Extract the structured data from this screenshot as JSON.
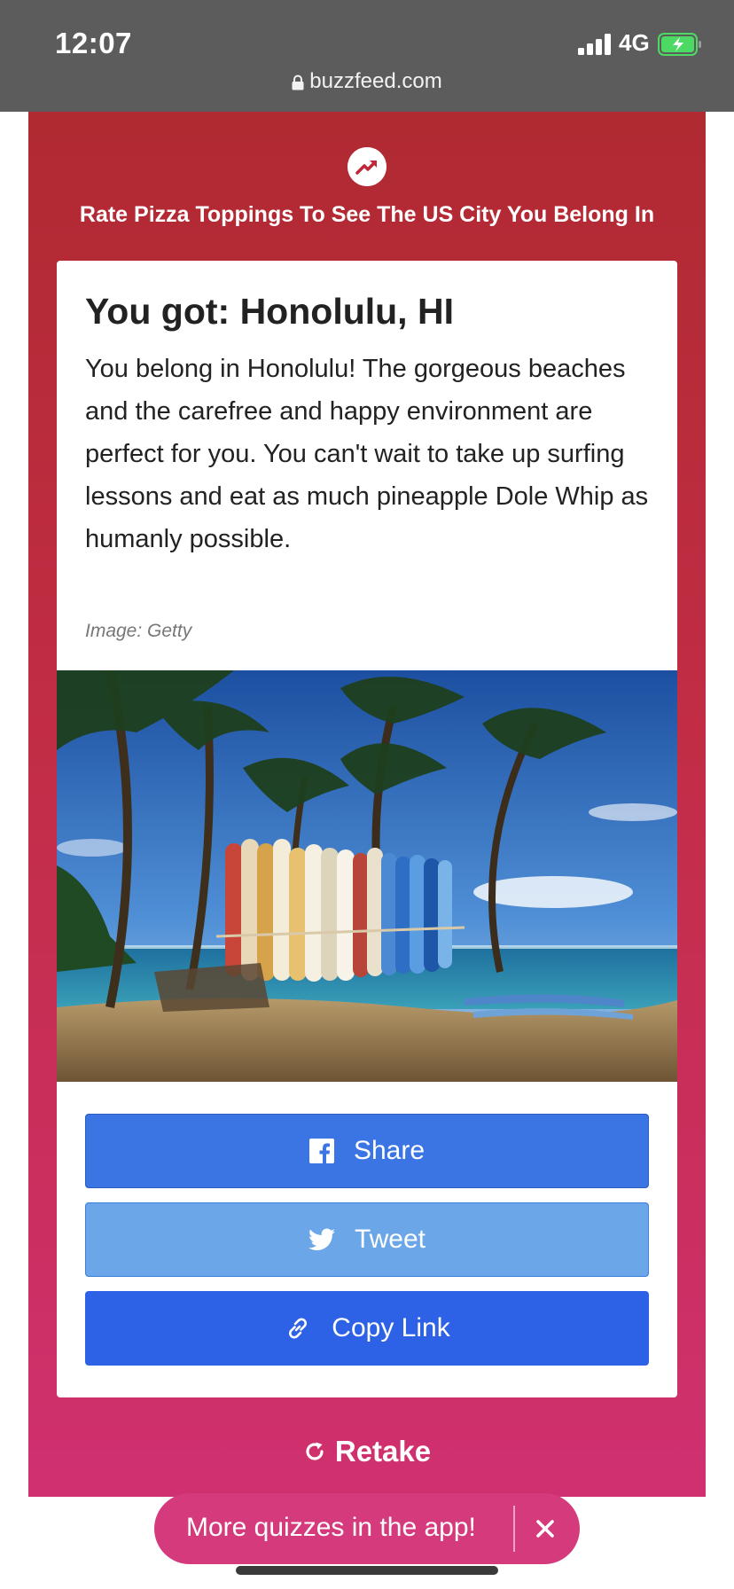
{
  "status_bar": {
    "time": "12:07",
    "network": "4G",
    "url": "buzzfeed.com"
  },
  "quiz": {
    "title": "Rate Pizza Toppings To See The US City You Belong In",
    "result_heading": "You got: Honolulu, HI",
    "result_description": "You belong in Honolulu! The gorgeous beaches and the carefree and happy environment are perfect for you. You can't wait to take up surfing lessons and eat as much pineapple Dole Whip as humanly possible.",
    "image_credit": "Image: Getty"
  },
  "share_buttons": {
    "facebook_label": "Share",
    "twitter_label": "Tweet",
    "copy_label": "Copy Link"
  },
  "retake_label": "Retake",
  "app_banner": {
    "label": "More quizzes in the app!"
  },
  "colors": {
    "status_bar": "#5c5c5c",
    "quiz_gradient_top": "#b02a32",
    "quiz_gradient_bottom": "#d03070",
    "facebook_blue": "#3a75e3",
    "twitter_blue": "#6aa6e8",
    "copy_blue": "#2e62e6",
    "banner_pink": "#d53a7c"
  },
  "icons": [
    "lock-icon",
    "signal-icon",
    "battery-charging-icon",
    "trending-icon",
    "facebook-icon",
    "twitter-icon",
    "link-icon",
    "retake-icon",
    "close-icon"
  ]
}
